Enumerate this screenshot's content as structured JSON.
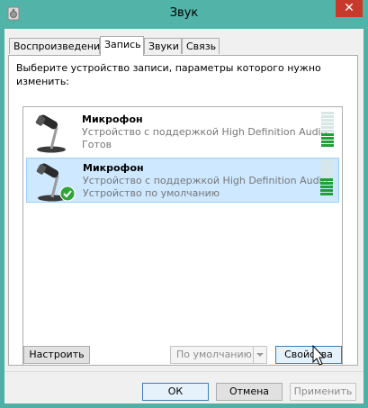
{
  "window": {
    "title": "Звук",
    "close_glyph": "✕"
  },
  "tabs": [
    {
      "label": "Воспроизведение",
      "active": false
    },
    {
      "label": "Запись",
      "active": true
    },
    {
      "label": "Звуки",
      "active": false
    },
    {
      "label": "Связь",
      "active": false
    }
  ],
  "panel": {
    "instruction": "Выберите устройство записи, параметры которого нужно изменить:"
  },
  "devices": [
    {
      "name": "Микрофон",
      "description": "Устройство с поддержкой High Definition Audio",
      "status": "Готов",
      "selected": false,
      "default": false,
      "level_segments_on": 4,
      "level_segments_total": 10
    },
    {
      "name": "Микрофон",
      "description": "Устройство с поддержкой High Definition Audio",
      "status": "Устройство по умолчанию",
      "selected": true,
      "default": true,
      "level_segments_on": 5,
      "level_segments_total": 10
    }
  ],
  "buttons": {
    "configure": "Настроить",
    "set_default": "По умолчанию",
    "properties": "Свойства",
    "ok": "ОК",
    "cancel": "Отмена",
    "apply": "Применить"
  },
  "colors": {
    "titlebar": "#52b3a8",
    "close": "#c7392b",
    "selection": "#cde8ff",
    "level_on": "#21a036"
  }
}
